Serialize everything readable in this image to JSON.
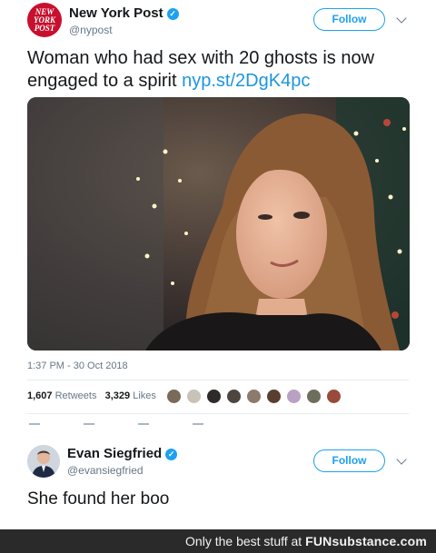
{
  "tweet": {
    "author_name": "New York Post",
    "author_handle": "@nypost",
    "avatar_lines": [
      "NEW",
      "YORK",
      "POST"
    ],
    "follow_label": "Follow",
    "text_line1": "Woman who had sex with 20 ghosts is now",
    "text_line2": "engaged to a spirit",
    "link": "nyp.st/2DgK4pc",
    "timestamp": "1:37 PM - 30 Oct 2018",
    "retweets_count": "1,607",
    "retweets_label": "Retweets",
    "likes_count": "3,329",
    "likes_label": "Likes",
    "brand_color": "#c8102e"
  },
  "reply": {
    "author_name": "Evan Siegfried",
    "author_handle": "@evansiegfried",
    "follow_label": "Follow",
    "text": "She found her boo"
  },
  "watermark": {
    "prefix": "Only the best stuff at",
    "brand": "FUNsubstance.com"
  },
  "colors": {
    "twitter_blue": "#1da1f2",
    "link_blue": "#1b95e0",
    "muted": "#657786"
  }
}
